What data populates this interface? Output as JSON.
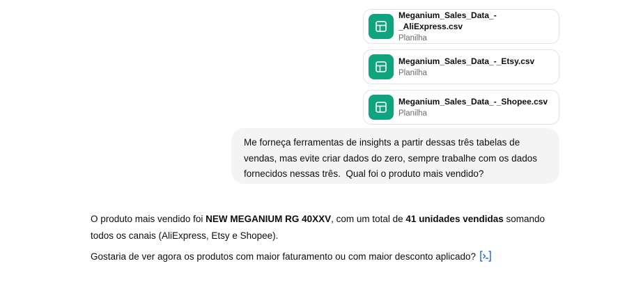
{
  "attachments": [
    {
      "name": "Meganium_Sales_Data_-_AliExpress.csv",
      "type": "Planilha",
      "icon": "spreadsheet-icon"
    },
    {
      "name": "Meganium_Sales_Data_-_Etsy.csv",
      "type": "Planilha",
      "icon": "spreadsheet-icon"
    },
    {
      "name": "Meganium_Sales_Data_-_Shopee.csv",
      "type": "Planilha",
      "icon": "spreadsheet-icon"
    }
  ],
  "user_message": {
    "line1": "Me forneça ferramentas de insights a partir dessas três tabelas de",
    "line2": "vendas, mas evite criar dados do zero, sempre trabalhe com os dados",
    "line3": "fornecidos nessas três.  Qual foi o produto mais vendido?"
  },
  "assistant_message": {
    "p1_a": "O produto mais vendido foi ",
    "p1_product": "NEW MEGANIUM RG 40XXV",
    "p1_b": ", com um total de ",
    "p1_units": "41 unidades vendidas",
    "p1_c": " somando",
    "p1_line2": "todos os canais (AliExpress, Etsy e Shopee).",
    "p2": "Gostaria de ver agora os produtos com maior faturamento ou com maior desconto aplicado?",
    "follow_icon": "code-interpreter-icon"
  },
  "colors": {
    "sheet_icon_bg": "#10a37f",
    "user_bubble_bg": "#f4f4f4",
    "link_icon": "#2f6bd8"
  }
}
